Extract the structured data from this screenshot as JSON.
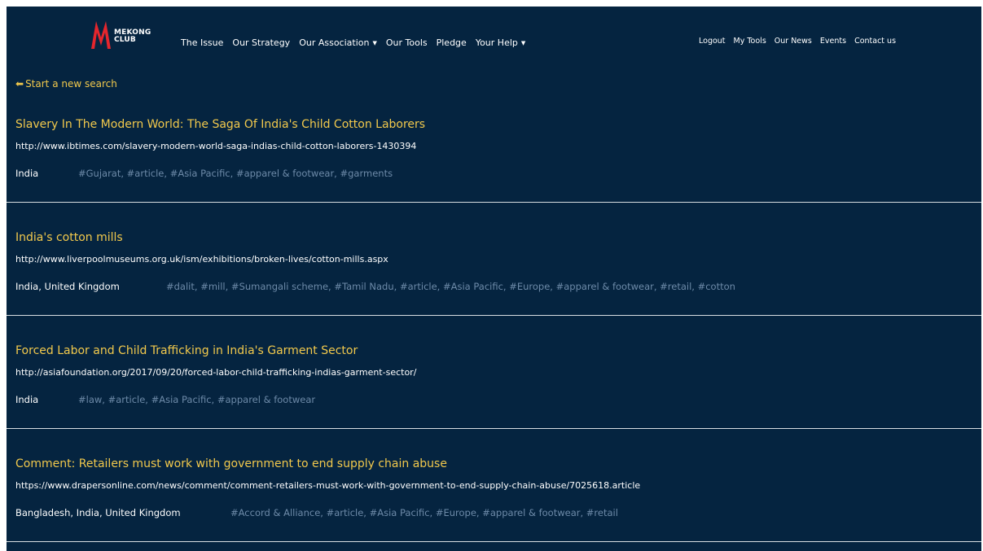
{
  "colors": {
    "background": "#052440",
    "accent": "#f2c94c",
    "tag": "#6d8aa8",
    "text": "#ffffff",
    "logo_red": "#e4262d"
  },
  "header": {
    "logo_line1": "MEKONG",
    "logo_line2": "CLUB",
    "nav_main": [
      {
        "label": "The Issue",
        "dropdown": false
      },
      {
        "label": "Our Strategy",
        "dropdown": false
      },
      {
        "label": "Our Association",
        "dropdown": true
      },
      {
        "label": "Our Tools",
        "dropdown": false
      },
      {
        "label": "Pledge",
        "dropdown": false
      },
      {
        "label": "Your Help",
        "dropdown": true
      }
    ],
    "nav_right": [
      "Logout",
      "My Tools",
      "Our News",
      "Events",
      "Contact us"
    ]
  },
  "back_link": {
    "label": "Start a new search",
    "icon": "left-arrow-icon"
  },
  "results": [
    {
      "title": "Slavery In The Modern World: The Saga Of India's Child Cotton Laborers",
      "url": "http://www.ibtimes.com/slavery-modern-world-saga-indias-child-cotton-laborers-1430394",
      "countries": "India",
      "tags": "#Gujarat, #article, #Asia Pacific, #apparel & footwear, #garments"
    },
    {
      "title": "India's cotton mills",
      "url": "http://www.liverpoolmuseums.org.uk/ism/exhibitions/broken-lives/cotton-mills.aspx",
      "countries": "India, United Kingdom",
      "tags": "#dalit, #mill, #Sumangali scheme, #Tamil Nadu, #article, #Asia Pacific, #Europe, #apparel & footwear, #retail, #cotton"
    },
    {
      "title": "Forced Labor and Child Trafficking in India's Garment Sector",
      "url": "http://asiafoundation.org/2017/09/20/forced-labor-child-trafficking-indias-garment-sector/",
      "countries": "India",
      "tags": "#law, #article, #Asia Pacific, #apparel & footwear"
    },
    {
      "title": "Comment: Retailers must work with government to end supply chain abuse",
      "url": "https://www.drapersonline.com/news/comment/comment-retailers-must-work-with-government-to-end-supply-chain-abuse/7025618.article",
      "countries": "Bangladesh, India, United Kingdom",
      "tags": "#Accord & Alliance, #article, #Asia Pacific, #Europe, #apparel & footwear, #retail"
    }
  ]
}
